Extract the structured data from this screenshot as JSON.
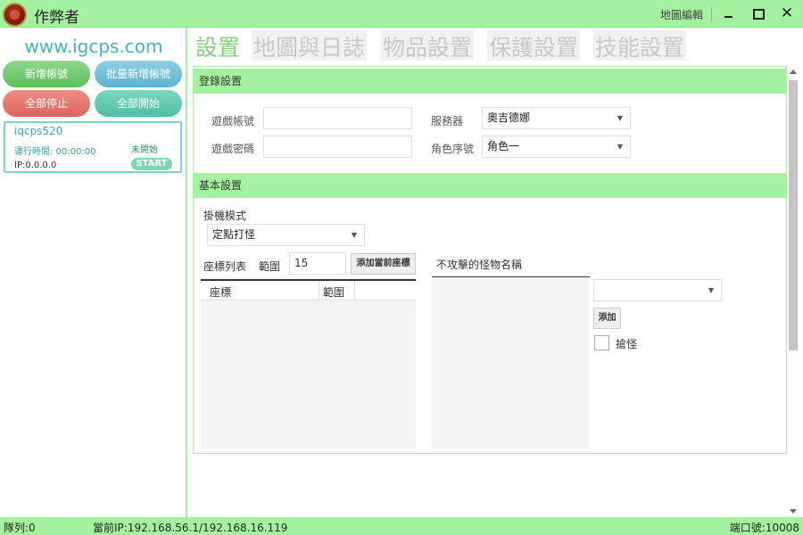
{
  "titlebar": {
    "app_title": "作弊者",
    "map_editor": "地圖編輯",
    "close_glyph": "✕"
  },
  "sidebar": {
    "site_url": "www.igcps.com",
    "buttons": {
      "new_profile": "新增帳號",
      "batch_new_profile": "批量新增帳號",
      "stop_all": "全部停止",
      "start_all": "全部開始"
    },
    "account": {
      "name": "iqcps520",
      "run_time": "運行時間: 00:00:00",
      "status": "未開始",
      "ip": "IP:0.0.0.0",
      "start_label": "START"
    }
  },
  "tabs": [
    {
      "label": "設置",
      "active": true
    },
    {
      "label": "地圖與日誌",
      "active": false
    },
    {
      "label": "物品設置",
      "active": false
    },
    {
      "label": "保護設置",
      "active": false
    },
    {
      "label": "技能設置",
      "active": false
    }
  ],
  "login_section": {
    "header": "登錄設置",
    "account_label": "遊戲帳號",
    "account_value": "",
    "password_label": "遊戲密碼",
    "password_value": "",
    "server_label": "服務器",
    "server_value": "奧吉德娜",
    "role_label": "角色序號",
    "role_value": "角色一"
  },
  "basic_section": {
    "header": "基本設置",
    "mode_label": "掛機模式",
    "mode_value": "定點打怪",
    "coord_list_label": "座標列表",
    "range_label": "範圍",
    "range_value": "15",
    "add_coord_button": "添加當前座標",
    "coord_columns": [
      "座標",
      "範圍"
    ],
    "monster_list_label": "不攻擊的怪物名稱",
    "monster_select_value": "",
    "add_button": "添加",
    "steal_checkbox_label": "搶怪",
    "steal_checked": false
  },
  "statusbar": {
    "queue": "隊列:0",
    "current_ip": "當前IP:192.168.56.1/192.168.16.119",
    "port": "端口號:10008"
  },
  "colors": {
    "accent": "#a4f2a0",
    "url_color": "#3db8b5",
    "active_tab": "#7fd07a"
  }
}
